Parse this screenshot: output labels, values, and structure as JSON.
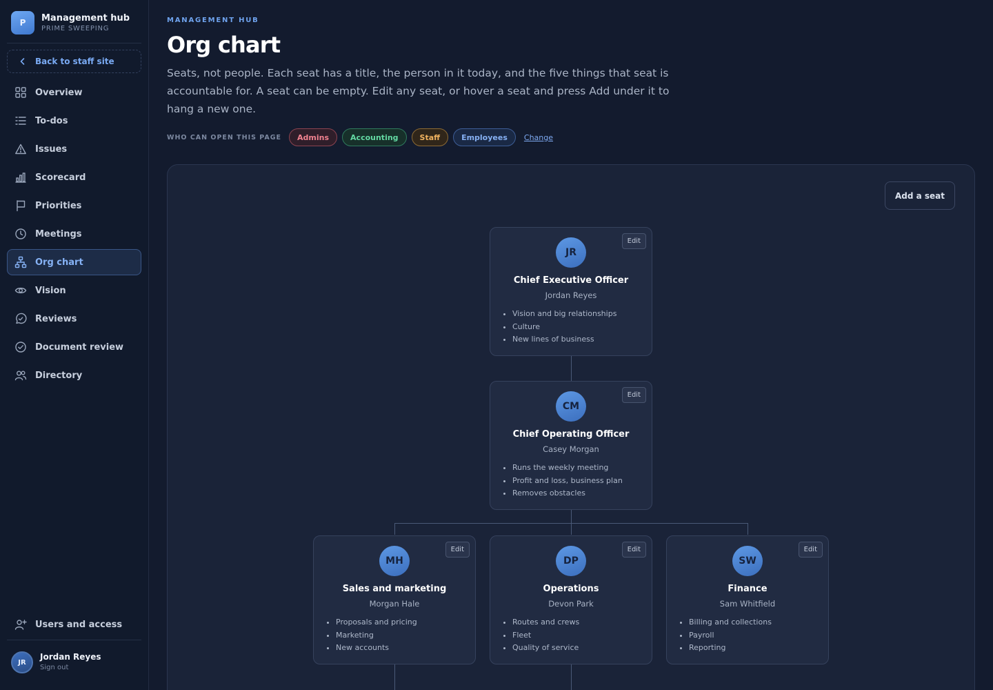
{
  "brand": {
    "logo_letter": "P",
    "title": "Management hub",
    "subtitle": "PRIME SWEEPING"
  },
  "sidebar": {
    "back_label": "Back to staff site",
    "items": [
      {
        "label": "Overview",
        "icon": "grid-icon"
      },
      {
        "label": "To-dos",
        "icon": "list-icon"
      },
      {
        "label": "Issues",
        "icon": "warning-triangle-icon"
      },
      {
        "label": "Scorecard",
        "icon": "bar-chart-icon"
      },
      {
        "label": "Priorities",
        "icon": "flag-icon"
      },
      {
        "label": "Meetings",
        "icon": "clock-icon"
      },
      {
        "label": "Org chart",
        "icon": "org-chart-icon",
        "active": true
      },
      {
        "label": "Vision",
        "icon": "eye-icon"
      },
      {
        "label": "Reviews",
        "icon": "chat-check-icon"
      },
      {
        "label": "Document review",
        "icon": "check-circle-icon"
      },
      {
        "label": "Directory",
        "icon": "people-icon"
      }
    ],
    "users_access_label": "Users and access",
    "user": {
      "initials": "JR",
      "name": "Jordan Reyes",
      "signout": "Sign out"
    }
  },
  "header": {
    "eyebrow": "MANAGEMENT HUB",
    "title": "Org chart",
    "description": "Seats, not people. Each seat has a title, the person in it today, and the five things that seat is accountable for. A seat can be empty. Edit any seat, or hover a seat and press Add under it to hang a new one."
  },
  "access": {
    "label": "WHO CAN OPEN THIS PAGE",
    "roles": [
      "Admins",
      "Accounting",
      "Staff",
      "Employees"
    ],
    "change_label": "Change"
  },
  "chart": {
    "add_seat_label": "Add a seat",
    "edit_label": "Edit",
    "seats": [
      {
        "initials": "JR",
        "title": "Chief Executive Officer",
        "person": "Jordan Reyes",
        "duties": [
          "Vision and big relationships",
          "Culture",
          "New lines of business"
        ]
      },
      {
        "initials": "CM",
        "title": "Chief Operating Officer",
        "person": "Casey Morgan",
        "duties": [
          "Runs the weekly meeting",
          "Profit and loss, business plan",
          "Removes obstacles"
        ]
      },
      {
        "initials": "MH",
        "title": "Sales and marketing",
        "person": "Morgan Hale",
        "duties": [
          "Proposals and pricing",
          "Marketing",
          "New accounts"
        ]
      },
      {
        "initials": "DP",
        "title": "Operations",
        "person": "Devon Park",
        "duties": [
          "Routes and crews",
          "Fleet",
          "Quality of service"
        ]
      },
      {
        "initials": "SW",
        "title": "Finance",
        "person": "Sam Whitfield",
        "duties": [
          "Billing and collections",
          "Payroll",
          "Reporting"
        ]
      }
    ]
  },
  "colors": {
    "accent": "#79a9f2",
    "background": "#131b2e",
    "admins": "#f08290",
    "accounting": "#63d9a2",
    "staff": "#f0b25f",
    "employees": "#86b0f3"
  }
}
